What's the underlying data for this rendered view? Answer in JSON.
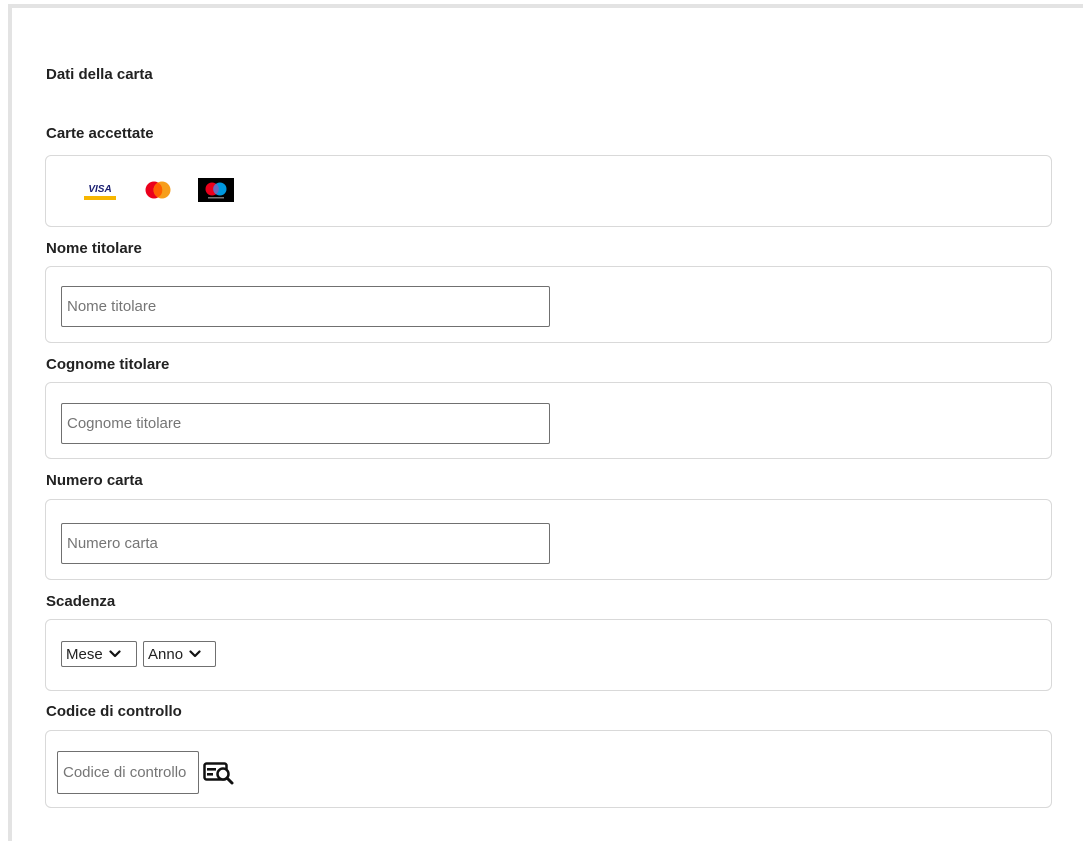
{
  "form": {
    "section_title": "Dati della carta",
    "accepted_cards_label": "Carte accettate",
    "accepted_cards": [
      {
        "name": "Visa",
        "icon": "visa-logo",
        "text": "VISA",
        "colors": [
          "#1a1f71",
          "#f7b600"
        ]
      },
      {
        "name": "Mastercard",
        "icon": "mastercard-logo",
        "colors": [
          "#eb001b",
          "#f79e1b"
        ]
      },
      {
        "name": "Maestro",
        "icon": "maestro-logo",
        "colors": [
          "#0099df",
          "#eb001b"
        ]
      }
    ],
    "holder_name": {
      "label": "Nome titolare",
      "placeholder": "Nome titolare",
      "value": ""
    },
    "holder_surname": {
      "label": "Cognome titolare",
      "placeholder": "Cognome titolare",
      "value": ""
    },
    "card_number": {
      "label": "Numero carta",
      "placeholder": "Numero carta",
      "value": ""
    },
    "expiry": {
      "label": "Scadenza",
      "month_selected": "Mese",
      "year_selected": "Anno"
    },
    "cvv": {
      "label": "Codice di controllo",
      "placeholder": "Codice di controllo",
      "value": "",
      "help_icon": "card-cvv-search-icon"
    }
  },
  "colors": {
    "frame": "#e3e3e3",
    "box_border": "#d9d9d9",
    "input_border": "#707070",
    "text": "#222222",
    "placeholder": "#757575"
  }
}
